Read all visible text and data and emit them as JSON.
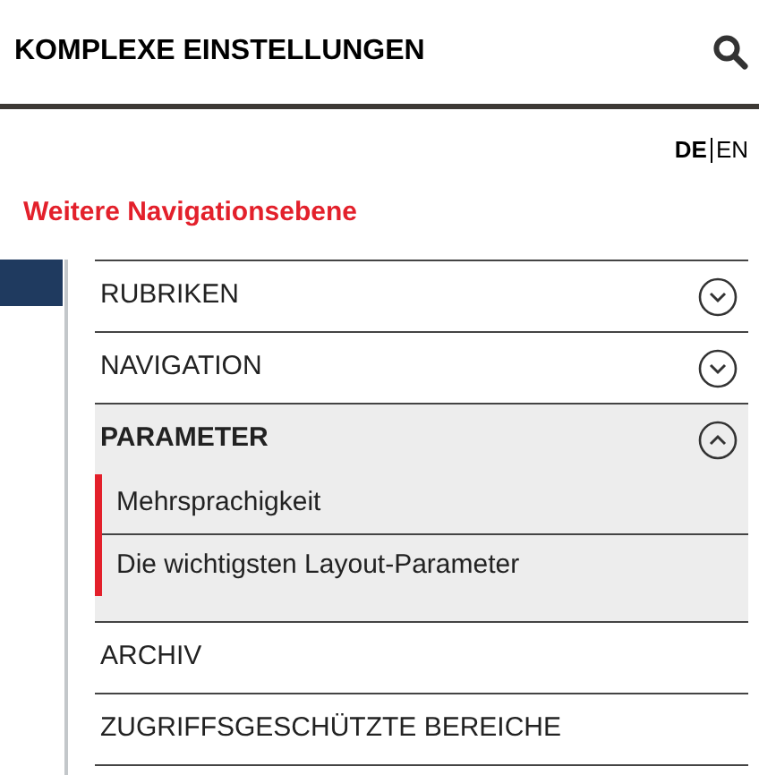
{
  "header": {
    "title": "KOMPLEXE EINSTELLUNGEN"
  },
  "languages": [
    {
      "label": "DE",
      "selected": true
    },
    {
      "label": "EN",
      "selected": false
    }
  ],
  "section_heading": "Weitere Navigationsebene",
  "menu": [
    {
      "label": "RUBRIKEN",
      "kind": "group",
      "expanded": false
    },
    {
      "label": "NAVIGATION",
      "kind": "group",
      "expanded": false
    },
    {
      "label": "PARAMETER",
      "kind": "group",
      "expanded": true,
      "children": [
        {
          "label": "Mehrsprachigkeit"
        },
        {
          "label": "Die wichtigsten Layout-Parameter"
        }
      ]
    },
    {
      "label": "ARCHIV",
      "kind": "link"
    },
    {
      "label": "ZUGRIFFSGESCHÜTZTE BEREICHE",
      "kind": "link"
    }
  ]
}
